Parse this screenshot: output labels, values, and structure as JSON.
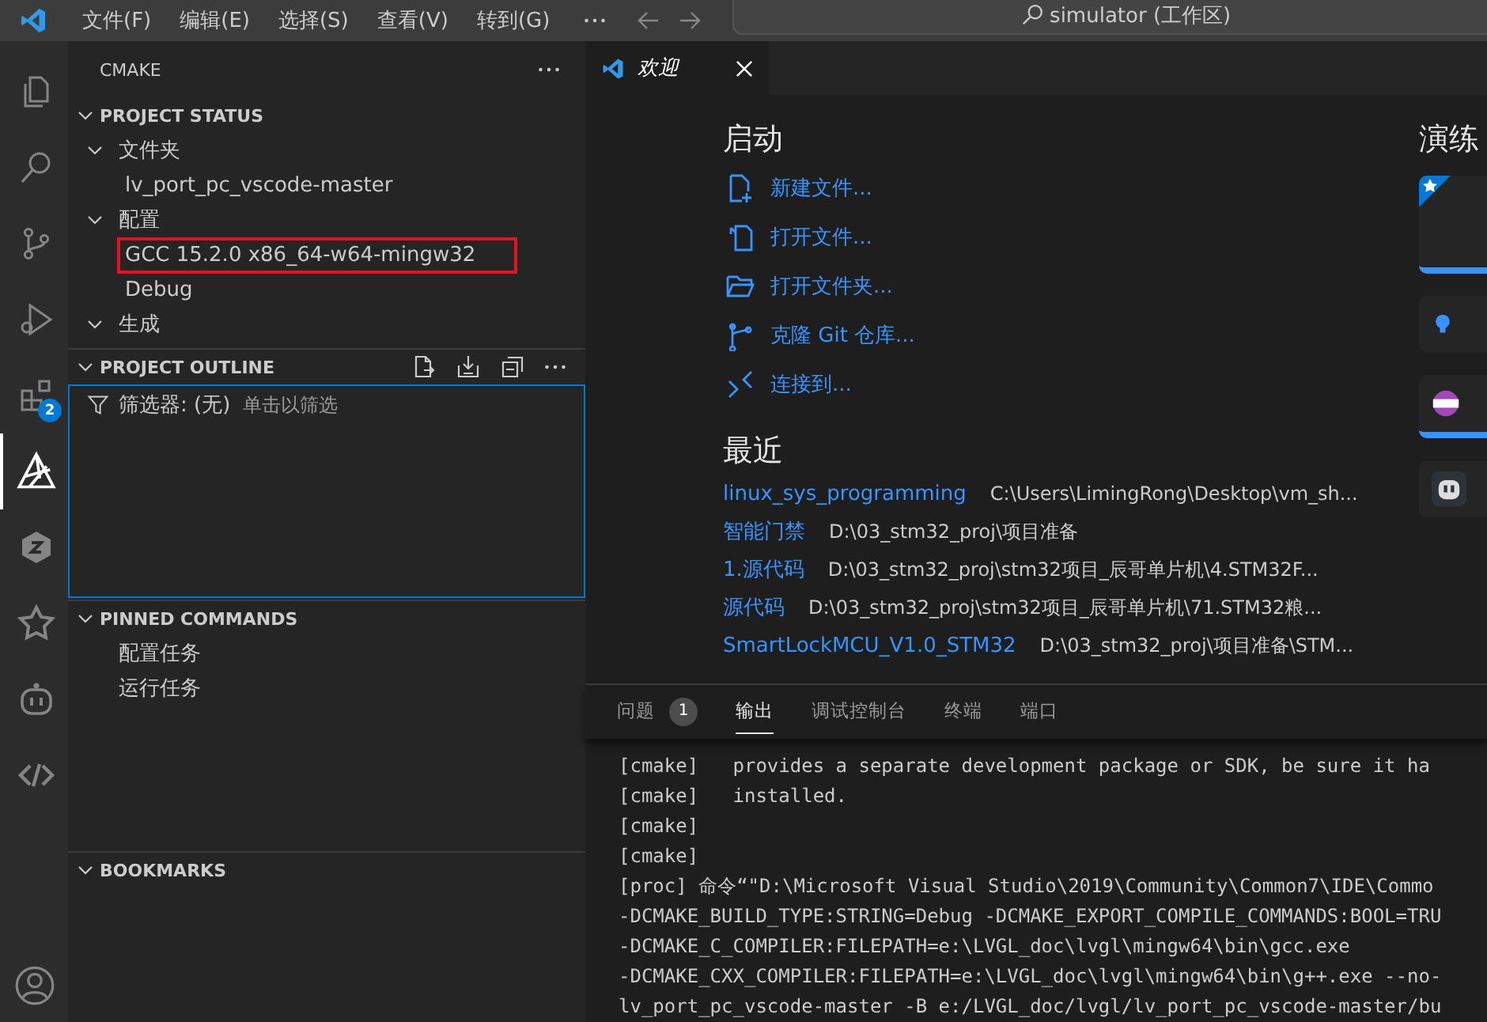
{
  "title_bar": {
    "menus": [
      "文件(F)",
      "编辑(E)",
      "选择(S)",
      "查看(V)",
      "转到(G)"
    ],
    "search": "simulator (工作区)"
  },
  "activity_bar": {
    "items": [
      {
        "kind": "files",
        "selected": false
      },
      {
        "kind": "search",
        "selected": false
      },
      {
        "kind": "source-control",
        "selected": false
      },
      {
        "kind": "run-debug",
        "selected": false
      },
      {
        "kind": "extensions",
        "selected": false,
        "badge": "2"
      },
      {
        "kind": "cmake",
        "selected": true
      },
      {
        "kind": "hexagon",
        "selected": false
      },
      {
        "kind": "star",
        "selected": false
      },
      {
        "kind": "robot",
        "selected": false
      },
      {
        "kind": "code",
        "selected": false
      }
    ]
  },
  "sidebar": {
    "title": "CMAKE",
    "project_status": {
      "header": "PROJECT STATUS",
      "expanded": true,
      "items": [
        {
          "label": "文件夹",
          "expanded": true,
          "children": [
            {
              "label": "lv_port_pc_vscode-master",
              "highlighted": false
            }
          ]
        },
        {
          "label": "配置",
          "expanded": true,
          "children": [
            {
              "label": "GCC 15.2.0 x86_64-w64-mingw32",
              "highlighted": true
            },
            {
              "label": "Debug",
              "highlighted": false
            }
          ]
        },
        {
          "label": "生成",
          "expanded": true
        }
      ]
    },
    "project_outline": {
      "header": "PROJECT OUTLINE",
      "expanded": true,
      "filter_label": "筛选器: (无)",
      "filter_hint": "单击以筛选"
    },
    "pinned_commands": {
      "header": "PINNED COMMANDS",
      "expanded": true,
      "items": [
        "配置任务",
        "运行任务"
      ]
    },
    "bookmarks": {
      "header": "BOOKMARKS",
      "expanded": true
    }
  },
  "editor_tabs": [
    {
      "label": "欢迎",
      "selected": true
    }
  ],
  "welcome": {
    "start": {
      "heading": "启动",
      "actions": [
        {
          "kind": "new-file",
          "label": "新建文件..."
        },
        {
          "kind": "open-file",
          "label": "打开文件..."
        },
        {
          "kind": "open-folder",
          "label": "打开文件夹..."
        },
        {
          "kind": "clone",
          "label": "克隆 Git 仓库..."
        },
        {
          "kind": "connect",
          "label": "连接到..."
        }
      ]
    },
    "recent": {
      "heading": "最近",
      "items": [
        {
          "name": "linux_sys_programming",
          "path": "C:\\Users\\LimingRong\\Desktop\\vm_sh..."
        },
        {
          "name": "智能门禁",
          "path": "D:\\03_stm32_proj\\项目准备"
        },
        {
          "name": "1.源代码",
          "path": "D:\\03_stm32_proj\\stm32项目_辰哥单片机\\4.STM32F..."
        },
        {
          "name": "源代码",
          "path": "D:\\03_stm32_proj\\stm32项目_辰哥单片机\\71.STM32粮..."
        },
        {
          "name": "SmartLockMCU_V1.0_STM32",
          "path": "D:\\03_stm32_proj\\项目准备\\STM..."
        }
      ]
    },
    "walkthroughs": {
      "heading": "演练",
      "cards": [
        {
          "kind": "featured",
          "started": true
        },
        {
          "kind": "bulb",
          "started": false
        },
        {
          "kind": "cpp",
          "started": true
        },
        {
          "kind": "robot",
          "started": false
        }
      ]
    }
  },
  "panel": {
    "tabs": [
      {
        "label": "问题",
        "badge": "1",
        "selected": false
      },
      {
        "label": "输出",
        "selected": true
      },
      {
        "label": "调试控制台",
        "selected": false
      },
      {
        "label": "终端",
        "selected": false
      },
      {
        "label": "端口",
        "selected": false
      }
    ],
    "output": [
      "[cmake]   provides a separate development package or SDK, be sure it ha",
      "[cmake]   installed.",
      "[cmake]",
      "[cmake]",
      "[proc] 命令“\"D:\\Microsoft Visual Studio\\2019\\Community\\Common7\\IDE\\Commo",
      "-DCMAKE_BUILD_TYPE:STRING=Debug -DCMAKE_EXPORT_COMPILE_COMMANDS:BOOL=TRU",
      "-DCMAKE_C_COMPILER:FILEPATH=e:\\LVGL_doc\\lvgl\\mingw64\\bin\\gcc.exe",
      "-DCMAKE_CXX_COMPILER:FILEPATH=e:\\LVGL_doc\\lvgl\\mingw64\\bin\\g++.exe --no-",
      "lv_port_pc_vscode-master -B e:/LVGL_doc/lvgl/lv_port_pc_vscode-master/bu"
    ]
  }
}
